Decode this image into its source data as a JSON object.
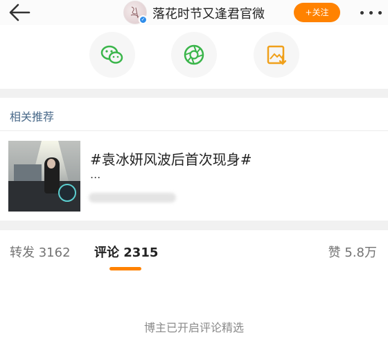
{
  "header": {
    "account_name": "落花时节又逢君官微",
    "follow_label": "+关注",
    "verified_mark": "✓",
    "icons": [
      "back-arrow-icon",
      "verified-icon",
      "more-icon"
    ]
  },
  "share": {
    "items": [
      {
        "icon": "wechat-icon",
        "color": "#3ab54a"
      },
      {
        "icon": "moments-icon",
        "color": "#3ab54a"
      },
      {
        "icon": "save-image-icon",
        "color": "#f0a01a"
      }
    ]
  },
  "related": {
    "title": "相关推荐",
    "topic": "#袁冰妍风波后首次现身#",
    "ellipsis": "..."
  },
  "tabs": {
    "repost": "转发 3162",
    "comment": "评论 2315",
    "like": "赞 5.8万",
    "active": "comment"
  },
  "comments": {
    "curated_note": "博主已开启评论精选"
  },
  "colors": {
    "accent": "#ff8200",
    "link_title": "#4a6a8a",
    "verified": "#2f8dea"
  }
}
